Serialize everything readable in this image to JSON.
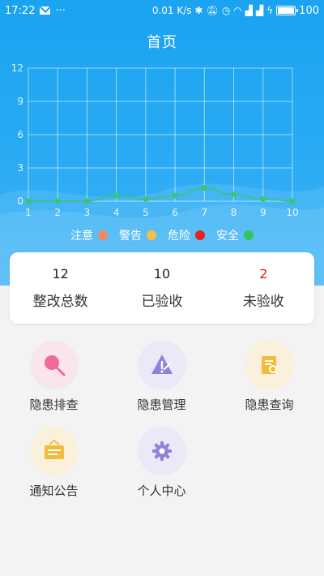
{
  "status_bar": {
    "time": "17:22",
    "dots": "···",
    "speed": "0.01 K/s",
    "battery_text": "100"
  },
  "header": {
    "title": "首页"
  },
  "chart_data": {
    "type": "line",
    "x": [
      1,
      2,
      3,
      4,
      5,
      6,
      7,
      8,
      9,
      10
    ],
    "y_ticks": [
      0,
      3,
      6,
      9,
      12
    ],
    "ylim": [
      0,
      12
    ],
    "series": [
      {
        "values": [
          0,
          0,
          0,
          0.5,
          0.2,
          0.5,
          1.2,
          0.6,
          0.2,
          0
        ],
        "color": "#3cc46e"
      }
    ],
    "legend": [
      {
        "label": "注意",
        "color": "#f08a5d"
      },
      {
        "label": "警告",
        "color": "#f4c142"
      },
      {
        "label": "危险",
        "color": "#e2231a"
      },
      {
        "label": "安全",
        "color": "#36c25e"
      }
    ],
    "grid": true
  },
  "stats": [
    {
      "value": "12",
      "label": "整改总数",
      "highlight": false
    },
    {
      "value": "10",
      "label": "已验收",
      "highlight": false
    },
    {
      "value": "2",
      "label": "未验收",
      "highlight": true
    }
  ],
  "menu": [
    {
      "label": "隐患排查",
      "icon": "magnifier-icon",
      "bg": "#f9e5ec",
      "color": "#f06b94"
    },
    {
      "label": "隐患管理",
      "icon": "warning-triangle-icon",
      "bg": "#ebe8f7",
      "color": "#8e83d8"
    },
    {
      "label": "隐患查询",
      "icon": "document-search-icon",
      "bg": "#fbf0dc",
      "color": "#f4bb3a"
    },
    {
      "label": "通知公告",
      "icon": "notice-board-icon",
      "bg": "#fbf0dc",
      "color": "#f4bb3a"
    },
    {
      "label": "个人中心",
      "icon": "gear-icon",
      "bg": "#ebe8f7",
      "color": "#8e83d8"
    }
  ]
}
